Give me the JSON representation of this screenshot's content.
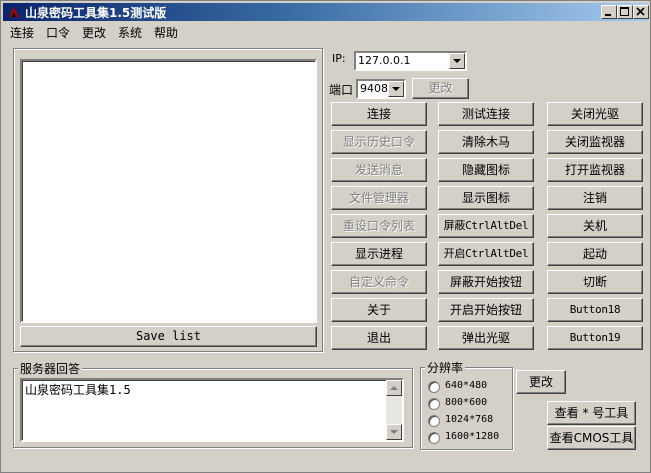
{
  "window": {
    "title": "山泉密码工具集1.5测试版"
  },
  "menu": [
    "连接",
    "口令",
    "更改",
    "系统",
    "帮助"
  ],
  "ip": {
    "label": "IP:",
    "value": "127.0.0.1"
  },
  "port": {
    "label": "端口",
    "value": "9408",
    "change_label": "更改"
  },
  "save_list_label": "Save list",
  "buttons": {
    "col1": [
      {
        "label": "连接",
        "enabled": true
      },
      {
        "label": "显示历史口令",
        "enabled": false
      },
      {
        "label": "发送消息",
        "enabled": false
      },
      {
        "label": "文件管理器",
        "enabled": false
      },
      {
        "label": "重设口令列表",
        "enabled": false
      },
      {
        "label": "显示进程",
        "enabled": true
      },
      {
        "label": "自定义命令",
        "enabled": false
      },
      {
        "label": "关于",
        "enabled": true
      },
      {
        "label": "退出",
        "enabled": true
      }
    ],
    "col2": [
      {
        "label": "测试连接",
        "enabled": true
      },
      {
        "label": "清除木马",
        "enabled": true
      },
      {
        "label": "隐藏图标",
        "enabled": true
      },
      {
        "label": "显示图标",
        "enabled": true
      },
      {
        "label": "屏蔽CtrlAltDel",
        "enabled": true
      },
      {
        "label": "开启CtrlAltDel",
        "enabled": true
      },
      {
        "label": "屏蔽开始按钮",
        "enabled": true
      },
      {
        "label": "开启开始按钮",
        "enabled": true
      },
      {
        "label": "弹出光驱",
        "enabled": true
      }
    ],
    "col3": [
      {
        "label": "关闭光驱",
        "enabled": true
      },
      {
        "label": "关闭监视器",
        "enabled": true
      },
      {
        "label": "打开监视器",
        "enabled": true
      },
      {
        "label": "注销",
        "enabled": true
      },
      {
        "label": "关机",
        "enabled": true
      },
      {
        "label": "起动",
        "enabled": true
      },
      {
        "label": "切断",
        "enabled": true
      },
      {
        "label": "Button18",
        "enabled": true
      },
      {
        "label": "Button19",
        "enabled": true
      }
    ]
  },
  "server_reply": {
    "label": "服务器回答",
    "text": "山泉密码工具集1.5"
  },
  "resolution": {
    "label": "分辨率",
    "options": [
      "640*480",
      "800*600",
      "1024*768",
      "1600*1280"
    ],
    "change_label": "更改"
  },
  "view_star_tool_label": "查看 * 号工具",
  "view_cmos_tool_label": "查看CMOS工具",
  "colors": {
    "title_start": "#0a246a",
    "title_end": "#a6caf0",
    "face": "#d4d0c8"
  }
}
